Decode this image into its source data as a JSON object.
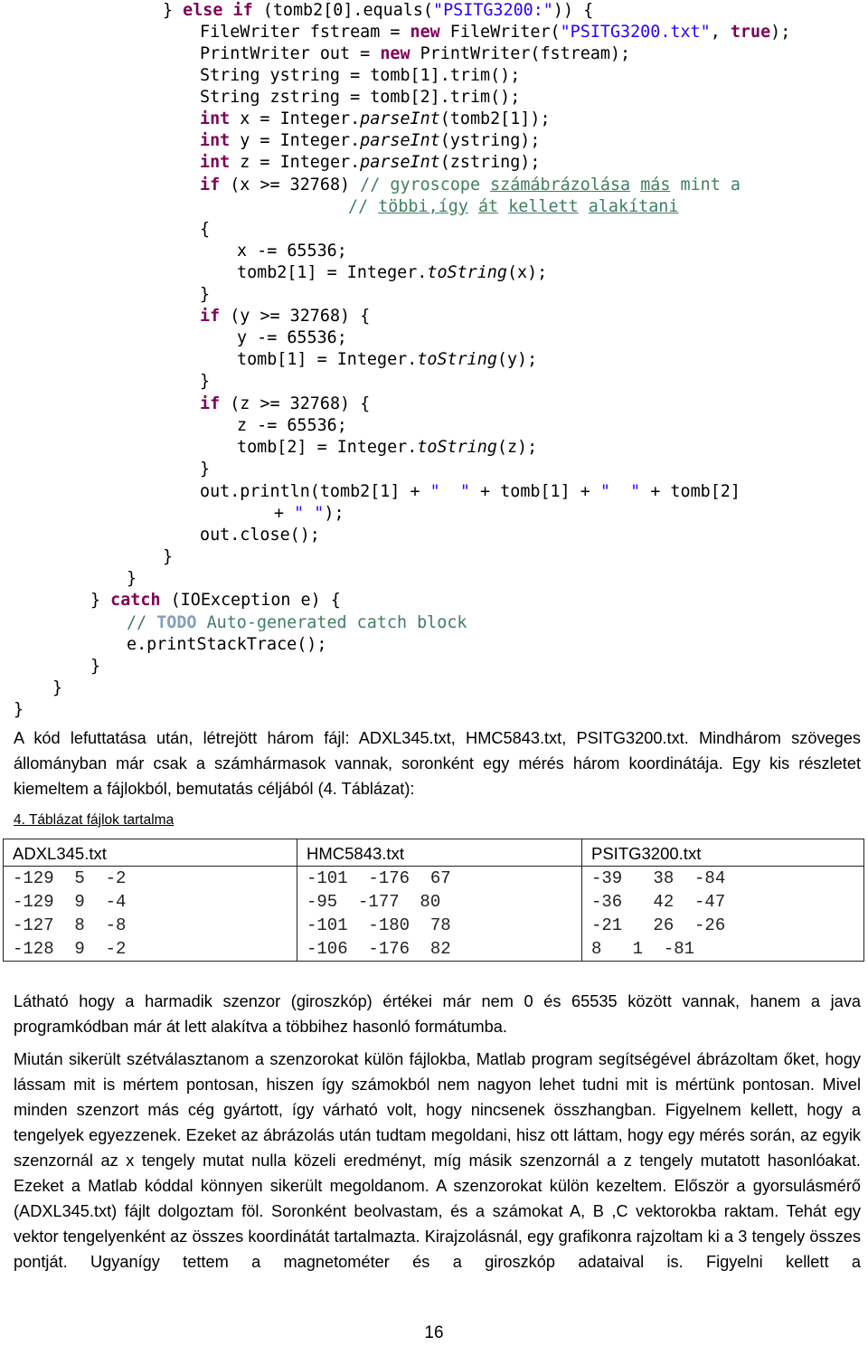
{
  "code": {
    "lines": [
      {
        "parts": [
          [
            "p",
            "} "
          ],
          [
            "kw",
            "else"
          ],
          [
            "p",
            " "
          ],
          [
            "kw",
            "if"
          ],
          [
            "p",
            " (tomb2[0].equals("
          ],
          [
            "str",
            "\"PSITG3200:\""
          ],
          [
            "p",
            ")) {"
          ]
        ]
      },
      {
        "parts": [
          [
            "p",
            "FileWriter fstream = "
          ],
          [
            "kw",
            "new"
          ],
          [
            "p",
            " FileWriter("
          ],
          [
            "str",
            "\"PSITG3200.txt\""
          ],
          [
            "p",
            ", "
          ],
          [
            "kw",
            "true"
          ],
          [
            "p",
            ");"
          ]
        ]
      },
      {
        "parts": [
          [
            "p",
            "PrintWriter out = "
          ],
          [
            "kw",
            "new"
          ],
          [
            "p",
            " PrintWriter(fstream);"
          ]
        ]
      },
      {
        "parts": [
          [
            "p",
            "String ystring = tomb[1].trim();"
          ]
        ]
      },
      {
        "parts": [
          [
            "p",
            "String zstring = tomb[2].trim();"
          ]
        ]
      },
      {
        "parts": [
          [
            "kw",
            "int"
          ],
          [
            "p",
            " x = Integer."
          ],
          [
            "it",
            "parseInt"
          ],
          [
            "p",
            "(tomb2[1]);"
          ]
        ]
      },
      {
        "parts": [
          [
            "kw",
            "int"
          ],
          [
            "p",
            " y = Integer."
          ],
          [
            "it",
            "parseInt"
          ],
          [
            "p",
            "(ystring);"
          ]
        ]
      },
      {
        "parts": [
          [
            "kw",
            "int"
          ],
          [
            "p",
            " z = Integer."
          ],
          [
            "it",
            "parseInt"
          ],
          [
            "p",
            "(zstring);"
          ]
        ]
      },
      {
        "parts": [
          [
            "kw",
            "if"
          ],
          [
            "p",
            " (x >= 32768) "
          ],
          [
            "cm",
            "// gyroscope "
          ],
          [
            "cmu",
            "számábrázolása"
          ],
          [
            "cm",
            " "
          ],
          [
            "cmu",
            "más"
          ],
          [
            "cm",
            " mint a"
          ]
        ]
      },
      {
        "parts": [
          [
            "cm",
            "// "
          ],
          [
            "cmu",
            "többi,így"
          ],
          [
            "cm",
            " "
          ],
          [
            "cmu",
            "át"
          ],
          [
            "cm",
            " "
          ],
          [
            "cmu",
            "kellett"
          ],
          [
            "cm",
            " "
          ],
          [
            "cmu",
            "alakítani"
          ]
        ]
      },
      {
        "parts": [
          [
            "p",
            "{"
          ]
        ]
      },
      {
        "parts": [
          [
            "p",
            "x -= 65536;"
          ]
        ]
      },
      {
        "parts": [
          [
            "p",
            "tomb2[1] = Integer."
          ],
          [
            "it",
            "toString"
          ],
          [
            "p",
            "(x);"
          ]
        ]
      },
      {
        "parts": [
          [
            "p",
            "}"
          ]
        ]
      },
      {
        "parts": [
          [
            "kw",
            "if"
          ],
          [
            "p",
            " (y >= 32768) {"
          ]
        ]
      },
      {
        "parts": [
          [
            "p",
            "y -= 65536;"
          ]
        ]
      },
      {
        "parts": [
          [
            "p",
            "tomb[1] = Integer."
          ],
          [
            "it",
            "toString"
          ],
          [
            "p",
            "(y);"
          ]
        ]
      },
      {
        "parts": [
          [
            "p",
            "}"
          ]
        ]
      },
      {
        "parts": [
          [
            "kw",
            "if"
          ],
          [
            "p",
            " (z >= 32768) {"
          ]
        ]
      },
      {
        "parts": [
          [
            "p",
            "z -= 65536;"
          ]
        ]
      },
      {
        "parts": [
          [
            "p",
            "tomb[2] = Integer."
          ],
          [
            "it",
            "toString"
          ],
          [
            "p",
            "(z);"
          ]
        ]
      },
      {
        "parts": [
          [
            "p",
            "}"
          ]
        ]
      },
      {
        "parts": [
          [
            "p",
            "out.println(tomb2[1] + "
          ],
          [
            "str",
            "\"  \""
          ],
          [
            "p",
            " + tomb[1] + "
          ],
          [
            "str",
            "\"  \""
          ],
          [
            "p",
            " + tomb[2]"
          ]
        ]
      },
      {
        "parts": [
          [
            "p",
            "+ "
          ],
          [
            "str",
            "\" \""
          ],
          [
            "p",
            ");"
          ]
        ]
      },
      {
        "parts": [
          [
            "p",
            "out.close();"
          ]
        ]
      },
      {
        "parts": [
          [
            "p",
            "}"
          ]
        ]
      },
      {
        "parts": [
          [
            "p",
            "}"
          ]
        ]
      },
      {
        "parts": [
          [
            "p",
            "} "
          ],
          [
            "kw",
            "catch"
          ],
          [
            "p",
            " (IOException e) {"
          ]
        ]
      },
      {
        "parts": [
          [
            "cm",
            "// "
          ],
          [
            "todo",
            "TODO"
          ],
          [
            "cm",
            " Auto-generated catch block"
          ]
        ]
      },
      {
        "parts": [
          [
            "p",
            "e.printStackTrace();"
          ]
        ]
      },
      {
        "parts": [
          [
            "p",
            "}"
          ]
        ]
      },
      {
        "parts": [
          [
            "p",
            "}"
          ]
        ]
      },
      {
        "parts": [
          [
            "p",
            "}"
          ]
        ]
      }
    ]
  },
  "paragraph1": "A kód lefuttatása után, létrejött három fájl: ADXL345.txt, HMC5843.txt, PSITG3200.txt. Mindhárom szöveges állományban már csak a számhármasok vannak, soronként egy mérés három koordinátája. Egy kis részletet kiemeltem a fájlokból, bemutatás céljából (4. Táblázat):",
  "table_caption": "4. Táblázat fájlok tartalma",
  "table": {
    "headers": [
      "ADXL345.txt",
      "HMC5843.txt",
      "PSITG3200.txt"
    ],
    "rows": [
      [
        "-129  5  -2",
        "-101  -176  67",
        "-39   38  -84"
      ],
      [
        "-129  9  -4",
        "-95  -177  80",
        "-36   42  -47"
      ],
      [
        "-127  8  -8",
        "-101  -180  78",
        "-21   26  -26"
      ],
      [
        "-128  9  -2",
        "-106  -176  82",
        "8   1  -81"
      ]
    ]
  },
  "paragraph2": "Látható hogy a harmadik szenzor (giroszkóp) értékei már nem 0 és 65535 között vannak, hanem a java programkódban már át lett alakítva a többihez hasonló formátumba.",
  "paragraph3": "Miután sikerült szétválasztanom a szenzorokat külön fájlokba, Matlab program segítségével ábrázoltam őket, hogy lássam mit is mértem pontosan, hiszen így számokból nem nagyon lehet tudni mit is mértünk pontosan. Mivel minden szenzort más cég gyártott, így várható volt, hogy nincsenek összhangban. Figyelnem kellett, hogy a tengelyek egyezzenek. Ezeket az ábrázolás után tudtam megoldani, hisz ott láttam, hogy egy mérés során, az egyik szenzornál az x tengely mutat nulla közeli eredményt, míg másik szenzornál a z tengely mutatott hasonlóakat. Ezeket a Matlab kóddal könnyen sikerült megoldanom. A szenzorokat külön kezeltem. Először a gyorsulásmérő (ADXL345.txt) fájlt dolgoztam föl. Soronként beolvastam, és a számokat A, B ,C vektorokba raktam. Tehát egy vektor tengelyenként az összes koordinátát tartalmazta. Kirajzolásnál, egy grafikonra rajzoltam ki a 3 tengely összes pontját. Ugyanígy tettem a magnetométer és a giroszkóp adataival is. Figyelni kellett a",
  "page_number": "16"
}
